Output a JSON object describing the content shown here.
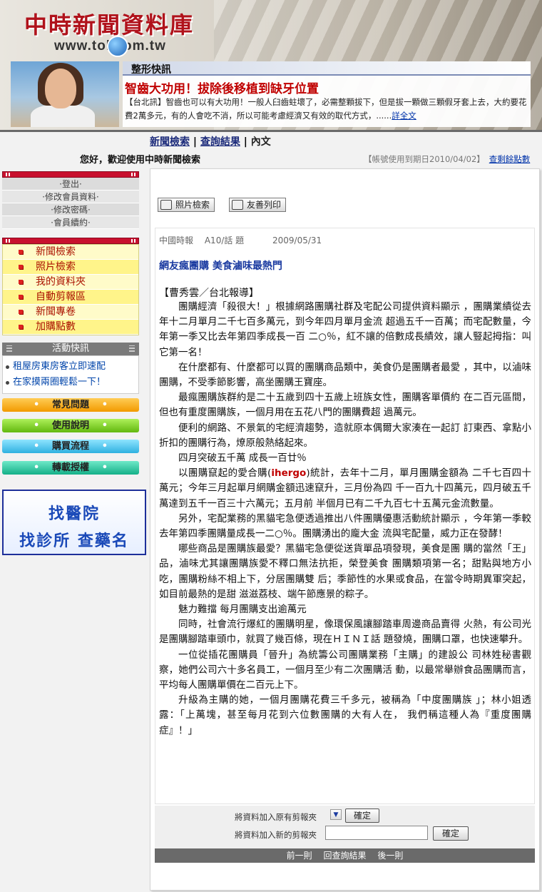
{
  "banner": {
    "logo_title": "中時新聞資料庫",
    "logo_url": "www.tol  com.tw",
    "section_label": "整形快訊",
    "news_title": "智齒大功用！拔除後移植到缺牙位置",
    "news_text": "【台北訊】智齒也可以有大功用！一般人臼齒蛀壞了，必需整顆拔下，但是拔一顆做三顆假牙套上去，大約要花費2萬多元，有的人會吃不消，所以可能考慮經濟又有效的取代方式，......",
    "news_more": "詳全文"
  },
  "topnav": {
    "search": "新聞檢索",
    "results": "查詢結果",
    "content": "內文"
  },
  "greeting": "您好，歡迎使用中時新聞檢索",
  "account": {
    "expiry": "【帳號使用到期日2010/04/02】",
    "points_link": "查剩餘點數"
  },
  "member_menu": [
    "登出",
    "修改會員資料",
    "修改密碼",
    "會員續約"
  ],
  "main_menu": [
    "新聞檢索",
    "照片檢索",
    "我的資料夾",
    "自動剪報區",
    "新聞專卷",
    "加購點數"
  ],
  "activity": {
    "title": "活動快訊",
    "items": [
      "租屋房東房客立即速配",
      "在家摸兩圈輕鬆一下！"
    ]
  },
  "pills": [
    "常見問題",
    "使用說明",
    "購買流程",
    "轉載授權"
  ],
  "ad": {
    "line1": "找醫院",
    "line2": "找診所 查藥名"
  },
  "toolbar": {
    "photo_search": "照片檢索",
    "print": "友善列印"
  },
  "article": {
    "source": "中國時報",
    "page": "A10/話 題",
    "date": "2009/05/31",
    "headline": "網友瘋團購 美食滷味最熱門",
    "reporter": "【曹秀雲／台北報導】",
    "paragraphs": [
      "團購經濟「殺很大！」根據網路團購社群及宅配公司提供資料顯示 ，團購業績從去年十二月單月二千七百多萬元，到今年四月單月金流 超過五千一百萬；而宅配數量，今年第一季又比去年第四季成長一百 二○％，紅不讓的倍數成長績效，讓人豎起拇指：叫它第一名！",
      "在什麼都有、什麼都可以買的團購商品類中，美食仍是團購者最愛 ，其中，以滷味團購，不受季節影響，高坐團購王寶座。",
      "最瘋團購族群約是二十五歲到四十五歲上班族女性，團購客單價約 在二百元區間，但也有重度團購族，一個月用在五花八門的團購費超 過萬元。",
      "便利的網路、不景氣的宅經濟趨勢，造就原本偶爾大家湊在一起訂 訂東西、拿點小折扣的團購行為，燎原般熱絡起來。",
      "四月突破五千萬 成長一百廿％",
      "以團購竄起的愛合購(ihergo)統計，去年十二月，單月團購金額為 二千七百四十萬元；今年三月起單月網購金額迅速竄升，三月份為四 千一百九十四萬元，四月破五千萬達到五千一百三十六萬元；五月前 半個月已有二千九百七十五萬元金流數量。",
      "另外，宅配業務的黑貓宅急便透過推出八件團購優惠活動統計顯示 ，今年第一季較去年第四季團購量成長一二○％。團購湧出的龐大金 流與宅配量，威力正在發酵！",
      "哪些商品是團購族最愛？黑貓宅急便從送貨單品項發現，美食是團 購的當然「王」品，滷味尤其讓團購族愛不釋口無法抗拒，榮登美食 團購類項第一名；甜點與地方小吃，團購粉絲不相上下，分居團購雙 后；季節性的水果或食品，在當令時期異軍突起，如目前最熱的是甜 滋滋荔枝、端午節應景的粽子。",
      "魅力難擋 每月團購支出逾萬元",
      "同時，社會流行爆紅的團購明星，像環保風讓腳踏車周邊商品賣得 火熱，有公司光是團購腳踏車頭巾，就買了幾百條，現在ＨＩＮＩ話 題發燒，團購口罩，也快速攀升。",
      "一位從插花團購員「晉升」為統籌公司團購業務「主購」的建設公 司林姓秘書觀察，她們公司六十多名員工，一個月至少有二次團購活 動，以最常舉辦食品團購而言，平均每人團購單價在二百元上下。",
      "升級為主購的她，一個月團購花費三千多元，被稱為「中度團購族 」；林小姐透露：「上萬塊，甚至每月花到六位數團購的大有人在， 我們稱這種人為『重度團購症』！」"
    ]
  },
  "clipping": {
    "existing_label": "將資料加入原有剪報夾",
    "new_label": "將資料加入新的剪報夾",
    "confirm": "確定",
    "select_value": "▼",
    "new_folder_value": ""
  },
  "pager": {
    "prev": "前一則",
    "back": "回查詢結果",
    "next": "後一則"
  }
}
